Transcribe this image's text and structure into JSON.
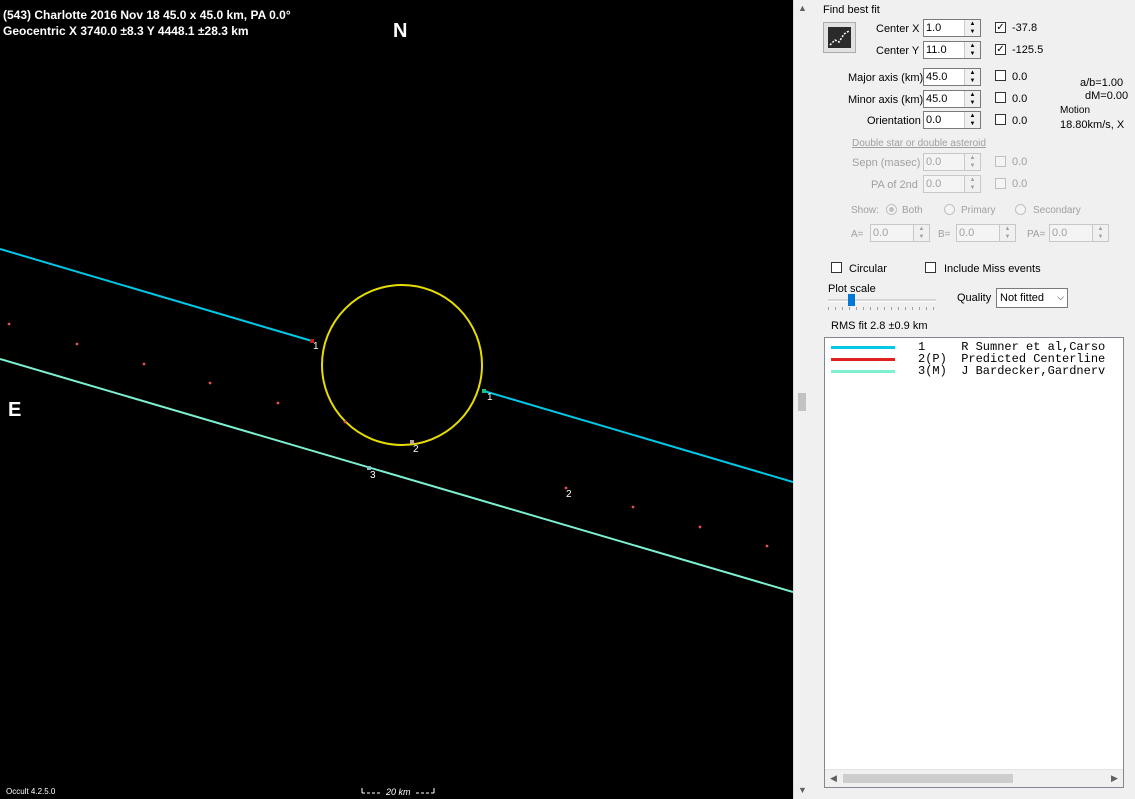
{
  "plot": {
    "title_line1": "(543) Charlotte  2016 Nov 18   45.0 x 45.0 km,  PA 0.0°",
    "title_line2": "Geocentric  X  3740.0 ±8.3  Y 4448.1 ±28.3 km",
    "north_label": "N",
    "east_label": "E",
    "version": "Occult 4.2.5.0",
    "scale_label": "20 km",
    "chord_labels": [
      "1",
      "1",
      "2",
      "3",
      "2"
    ],
    "colors": {
      "chord1": "#00c8e6",
      "chord3": "#7ef0d2",
      "ellipse": "#e6dc00",
      "predicted_dots": "#e05050"
    }
  },
  "panel": {
    "find_best_fit": "Find best fit",
    "center_x": {
      "label": "Center X",
      "value": "1.0",
      "checked": true,
      "result": "-37.8"
    },
    "center_y": {
      "label": "Center Y",
      "value": "11.0",
      "checked": true,
      "result": "-125.5"
    },
    "major_axis": {
      "label": "Major axis (km)",
      "value": "45.0",
      "checked": false,
      "result": "0.0"
    },
    "minor_axis": {
      "label": "Minor axis (km)",
      "value": "45.0",
      "checked": false,
      "result": "0.0"
    },
    "orientation": {
      "label": "Orientation",
      "value": "0.0",
      "checked": false,
      "result": "0.0"
    },
    "ab_ratio": "a/b=1.00",
    "dm": "dM=0.00",
    "motion_label": "Motion",
    "motion_value": "18.80km/s, X",
    "double_star_header": "Double star  or  double asteroid",
    "sepn": {
      "label": "Sepn (masec)",
      "value": "0.0",
      "result": "0.0"
    },
    "pa2nd": {
      "label": "PA of 2nd",
      "value": "0.0",
      "result": "0.0"
    },
    "show_label": "Show:",
    "show_options": [
      "Both",
      "Primary",
      "Secondary"
    ],
    "a_label": "A=",
    "a_value": "0.0",
    "b_label": "B=",
    "b_value": "0.0",
    "pa_label": "PA=",
    "pa_value": "0.0",
    "circular": "Circular",
    "include_miss": "Include Miss events",
    "plot_scale": "Plot scale",
    "quality_label": "Quality",
    "quality_value": "Not fitted",
    "rms_fit": "RMS fit 2.8 ±0.9 km",
    "legend": [
      {
        "text": "1     R Sumner et al,Carso",
        "color": "#00c8e6"
      },
      {
        "text": "2(P)  Predicted Centerline",
        "color": "#e02020"
      },
      {
        "text": "3(M)  J Bardecker,Gardnerv",
        "color": "#7ef0d2"
      }
    ]
  }
}
